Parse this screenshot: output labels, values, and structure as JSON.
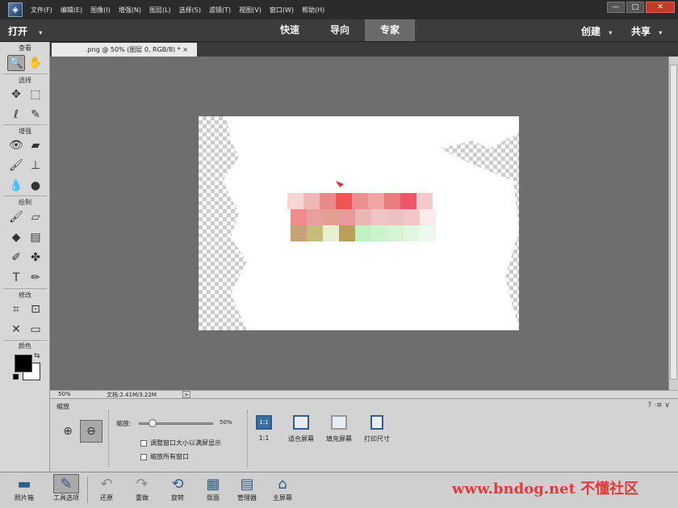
{
  "menu": {
    "items": [
      "文件(F)",
      "编辑(E)",
      "图像(I)",
      "增强(N)",
      "图层(L)",
      "选择(S)",
      "滤镜(T)",
      "视图(V)",
      "窗口(W)",
      "帮助(H)"
    ],
    "window_controls": [
      "—",
      "□",
      "✕"
    ]
  },
  "modebar": {
    "open_label": "打开",
    "tabs": [
      {
        "label": "快速",
        "active": false
      },
      {
        "label": "导向",
        "active": false
      },
      {
        "label": "专家",
        "active": true
      }
    ],
    "create_label": "创建",
    "share_label": "共享"
  },
  "toolbox": {
    "sections": {
      "view": "查看",
      "select": "选择",
      "enhance": "增强",
      "draw": "绘制",
      "modify": "修改",
      "color": "颜色"
    },
    "foreground_color": "#000000",
    "background_color": "#ffffff"
  },
  "document": {
    "tab_title": ".png @ 50% (图层 0, RGB/8) * ×"
  },
  "status": {
    "zoom": "50%",
    "doc_info": "文档:2.41M/3.22M",
    "arrow": ">"
  },
  "options": {
    "title": "缩放",
    "help": "? ·≡ ∨",
    "zoom_label": "缩放:",
    "zoom_value": "50%",
    "zoom_fraction": 0.14,
    "checkbox1": "调整窗口大小以满屏显示",
    "checkbox2": "缩放所有窗口",
    "fit_buttons": [
      "1:1",
      "适合屏幕",
      "填充屏幕",
      "打印尺寸"
    ],
    "one_to_one_icon": "1:1"
  },
  "taskbar": {
    "photo_bin": "照片箱",
    "tool_options": "工具选项",
    "undo": "还原",
    "redo": "重做",
    "rotate": "旋转",
    "layout": "版面",
    "organizer": "管理器",
    "home": "主屏幕",
    "watermark": "www.bndog.net 不懂社区"
  },
  "colors": {
    "accent": "#2f5d8c",
    "menubar": "#2b2b2b",
    "canvas": "#6e6e6e"
  }
}
